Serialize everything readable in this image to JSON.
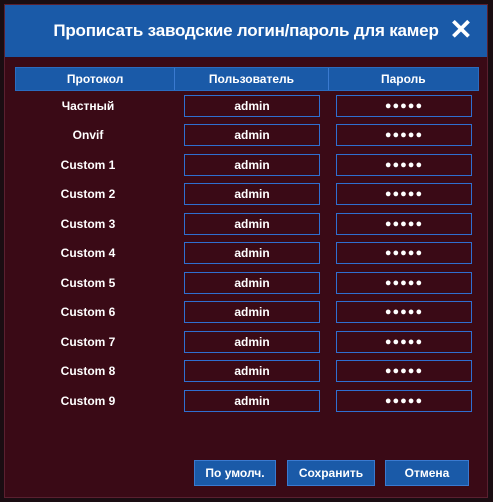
{
  "dialog": {
    "title": "Прописать заводские логин/пароль для камер",
    "close_glyph": "✕"
  },
  "table": {
    "headers": [
      "Протокол",
      "Пользователь",
      "Пароль"
    ],
    "rows": [
      {
        "protocol": "Частный",
        "user": "admin",
        "password": "●●●●●"
      },
      {
        "protocol": "Onvif",
        "user": "admin",
        "password": "●●●●●"
      },
      {
        "protocol": "Custom 1",
        "user": "admin",
        "password": "●●●●●"
      },
      {
        "protocol": "Custom 2",
        "user": "admin",
        "password": "●●●●●"
      },
      {
        "protocol": "Custom 3",
        "user": "admin",
        "password": "●●●●●"
      },
      {
        "protocol": "Custom 4",
        "user": "admin",
        "password": "●●●●●"
      },
      {
        "protocol": "Custom 5",
        "user": "admin",
        "password": "●●●●●"
      },
      {
        "protocol": "Custom 6",
        "user": "admin",
        "password": "●●●●●"
      },
      {
        "protocol": "Custom 7",
        "user": "admin",
        "password": "●●●●●"
      },
      {
        "protocol": "Custom 8",
        "user": "admin",
        "password": "●●●●●"
      },
      {
        "protocol": "Custom 9",
        "user": "admin",
        "password": "●●●●●"
      }
    ]
  },
  "buttons": {
    "default_label": "По умолч.",
    "save_label": "Сохранить",
    "cancel_label": "Отмена"
  }
}
